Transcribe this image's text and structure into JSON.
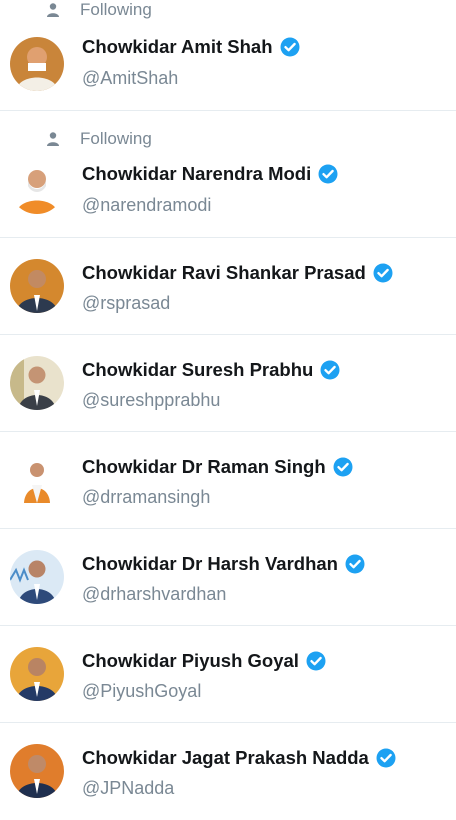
{
  "accent": "#1da1f2",
  "icons": {
    "verified": "verified-badge-icon",
    "social_context": "person-icon"
  },
  "accounts": [
    {
      "social_context": "Following",
      "name": "Chowkidar Amit Shah",
      "handle": "@AmitShah",
      "verified": true
    },
    {
      "social_context": "Following",
      "name": "Chowkidar Narendra Modi",
      "handle": "@narendramodi",
      "verified": true
    },
    {
      "social_context": "",
      "name": "Chowkidar Ravi Shankar Prasad",
      "handle": "@rsprasad",
      "verified": true
    },
    {
      "social_context": "",
      "name": "Chowkidar Suresh Prabhu",
      "handle": "@sureshpprabhu",
      "verified": true
    },
    {
      "social_context": "",
      "name": "Chowkidar Dr Raman Singh",
      "handle": "@drramansingh",
      "verified": true
    },
    {
      "social_context": "",
      "name": "Chowkidar Dr Harsh Vardhan",
      "handle": "@drharshvardhan",
      "verified": true
    },
    {
      "social_context": "",
      "name": "Chowkidar Piyush Goyal",
      "handle": "@PiyushGoyal",
      "verified": true
    },
    {
      "social_context": "",
      "name": "Chowkidar Jagat Prakash Nadda",
      "handle": "@JPNadda",
      "verified": true
    }
  ]
}
